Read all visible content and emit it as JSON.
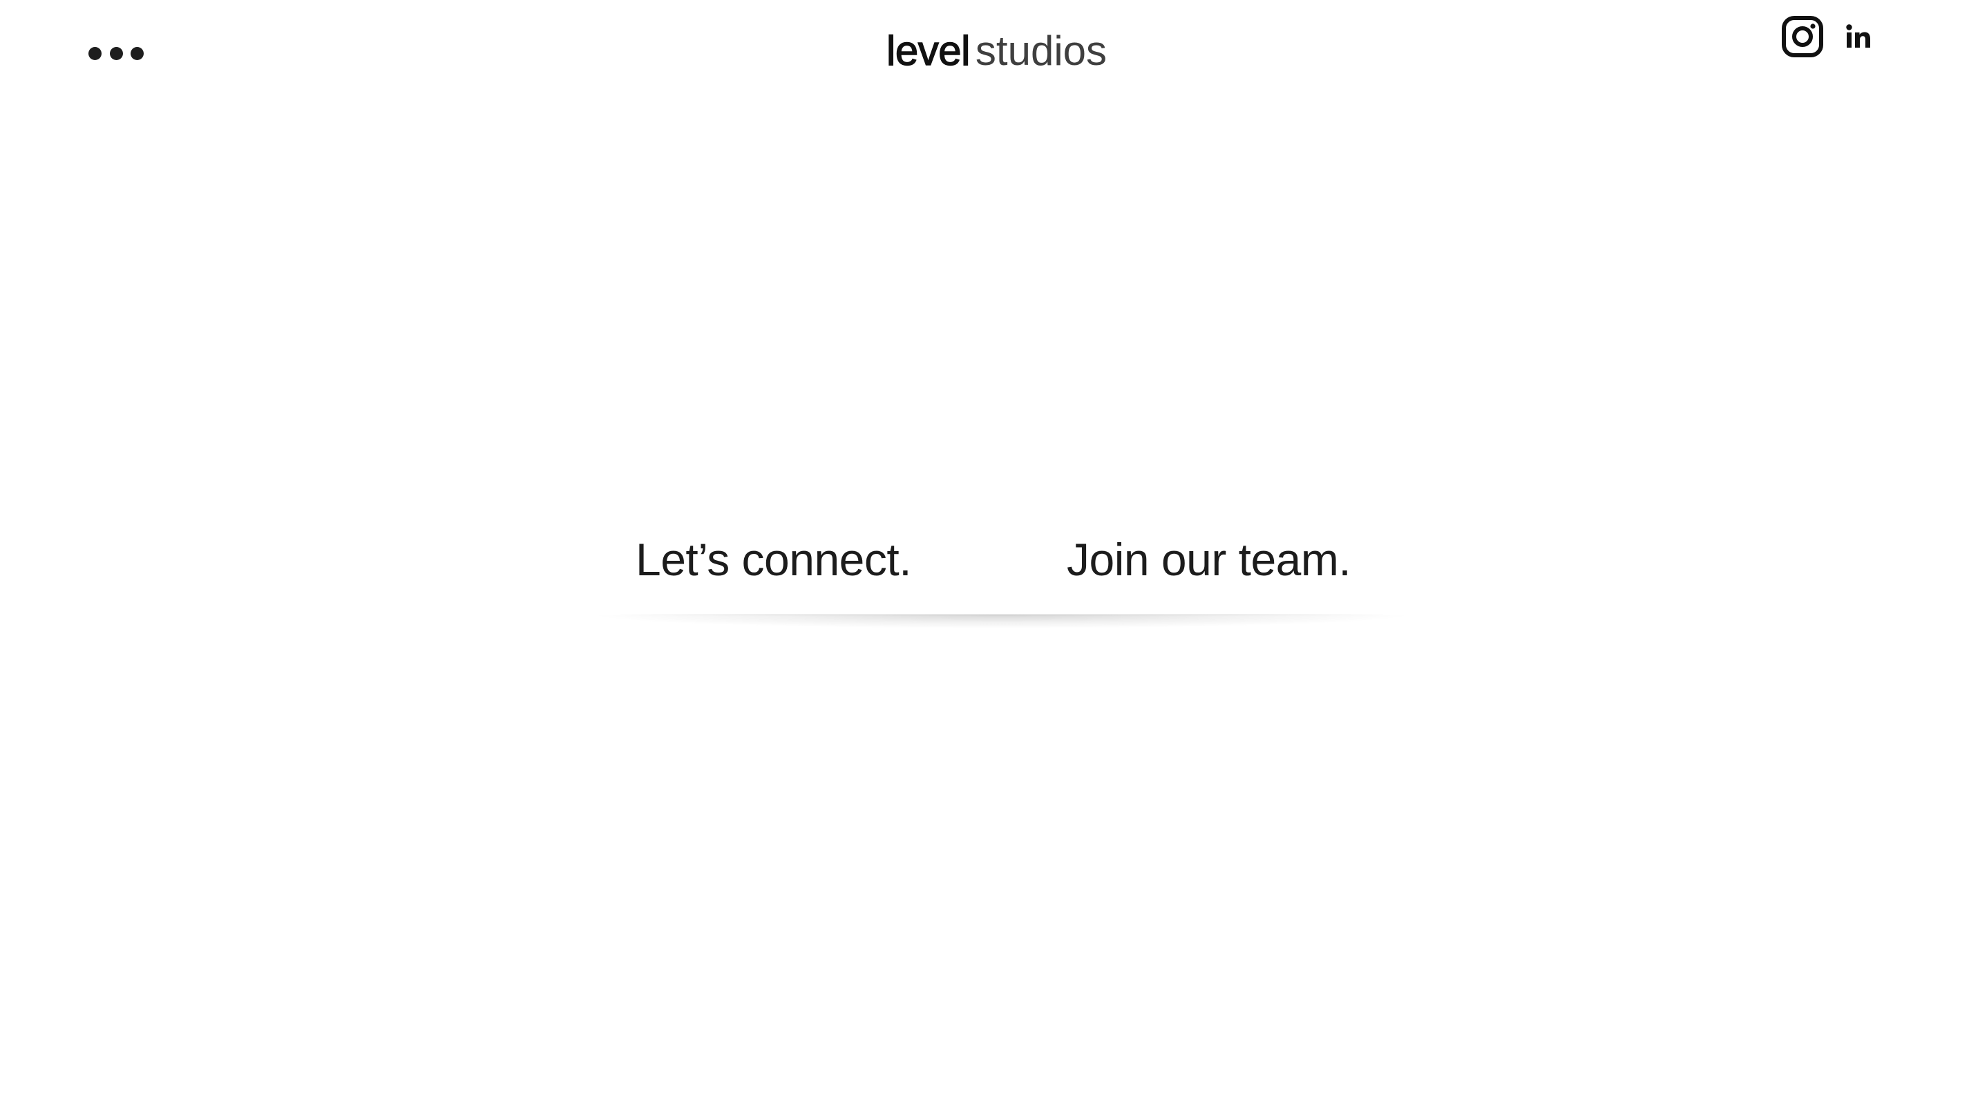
{
  "header": {
    "menu": {
      "icon": "more-horizontal-icon"
    },
    "logo": {
      "bold": "level",
      "light": "studios"
    },
    "social": [
      {
        "name": "Instagram",
        "icon": "instagram-icon"
      },
      {
        "name": "LinkedIn",
        "icon": "linkedin-icon",
        "glyph": "in"
      }
    ]
  },
  "main": {
    "links": [
      {
        "label": "Let’s connect."
      },
      {
        "label": "Join our team."
      }
    ]
  },
  "colors": {
    "background": "#ffffff",
    "text": "#1c1c1c"
  }
}
